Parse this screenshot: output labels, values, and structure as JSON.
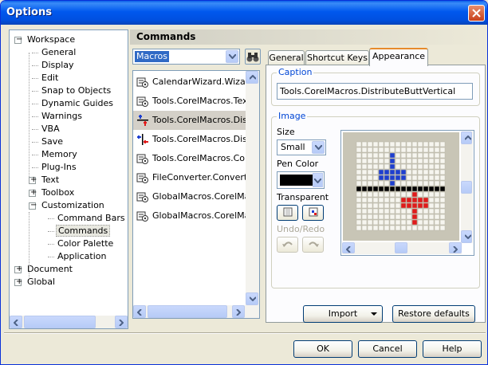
{
  "window": {
    "title": "Options"
  },
  "tree": {
    "items": [
      {
        "label": "Workspace",
        "level": 0,
        "expander": "−"
      },
      {
        "label": "General",
        "level": 1
      },
      {
        "label": "Display",
        "level": 1
      },
      {
        "label": "Edit",
        "level": 1
      },
      {
        "label": "Snap to Objects",
        "level": 1
      },
      {
        "label": "Dynamic Guides",
        "level": 1
      },
      {
        "label": "Warnings",
        "level": 1
      },
      {
        "label": "VBA",
        "level": 1
      },
      {
        "label": "Save",
        "level": 1
      },
      {
        "label": "Memory",
        "level": 1
      },
      {
        "label": "Plug-Ins",
        "level": 1
      },
      {
        "label": "Text",
        "level": 1,
        "expander": "+"
      },
      {
        "label": "Toolbox",
        "level": 1,
        "expander": "+"
      },
      {
        "label": "Customization",
        "level": 1,
        "expander": "−"
      },
      {
        "label": "Command Bars",
        "level": 2
      },
      {
        "label": "Commands",
        "level": 2,
        "selected": true
      },
      {
        "label": "Color Palette",
        "level": 2
      },
      {
        "label": "Application",
        "level": 2
      },
      {
        "label": "Document",
        "level": 0,
        "expander": "+"
      },
      {
        "label": "Global",
        "level": 0,
        "expander": "+"
      }
    ]
  },
  "commands": {
    "header": "Commands",
    "category": "Macros",
    "items": [
      {
        "label": "CalendarWizard.Wizard.",
        "icon": "macro-icon"
      },
      {
        "label": "Tools.CorelMacros.TextL",
        "icon": "macro-icon"
      },
      {
        "label": "Tools.CorelMacros.Distri",
        "icon": "distribute-vertical-icon",
        "selected": true
      },
      {
        "label": "Tools.CorelMacros.Distri",
        "icon": "distribute-horizontal-icon"
      },
      {
        "label": "Tools.CorelMacros.Conv",
        "icon": "macro-icon"
      },
      {
        "label": "FileConverter.Converter",
        "icon": "macro-icon"
      },
      {
        "label": "GlobalMacros.CorelMacr",
        "icon": "macro-icon"
      },
      {
        "label": "GlobalMacros.CorelMacr",
        "icon": "macro-icon"
      }
    ]
  },
  "tabs": [
    {
      "label": "General"
    },
    {
      "label": "Shortcut Keys"
    },
    {
      "label": "Appearance",
      "active": true
    }
  ],
  "appearance": {
    "caption_group": "Caption",
    "caption_value": "Tools.CorelMacros.DistributeButtVertical",
    "image_group": "Image",
    "size_label": "Size",
    "size_value": "Small",
    "pen_color_label": "Pen Color",
    "pen_color": "#000000",
    "transparent_label": "Transparent",
    "undo_redo_label": "Undo/Redo",
    "import_label": "Import",
    "restore_label": "Restore defaults"
  },
  "footer": {
    "ok": "OK",
    "cancel": "Cancel",
    "help": "Help"
  },
  "colors": {
    "title_bar": "#0058ee",
    "selection": "#316ac5",
    "icon_blue": "#1e3fd0",
    "icon_red": "#e01b1b"
  }
}
